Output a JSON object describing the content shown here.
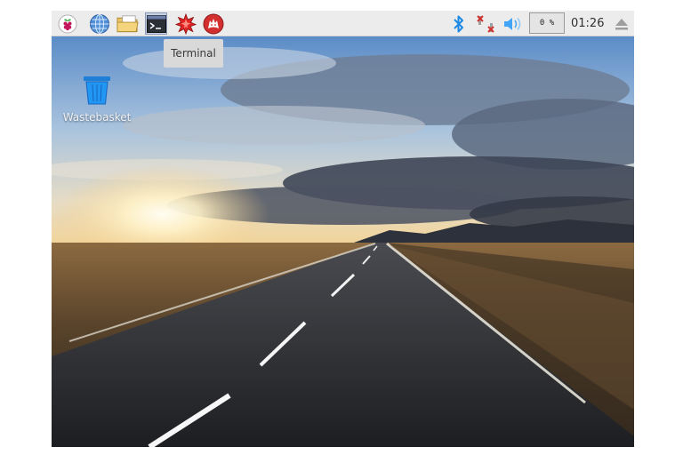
{
  "taskbar": {
    "apps": [
      {
        "name": "raspberry-menu-icon"
      },
      {
        "name": "web-browser-icon"
      },
      {
        "name": "file-manager-icon"
      },
      {
        "name": "terminal-icon"
      },
      {
        "name": "mathematica-icon"
      },
      {
        "name": "wolfram-icon"
      }
    ],
    "tray": {
      "cpu_label": "0 %",
      "clock": "01:26"
    }
  },
  "tooltip": {
    "text": "Terminal"
  },
  "desktop": {
    "icons": [
      {
        "label": "Wastebasket"
      }
    ]
  },
  "colors": {
    "taskbar_bg": "#ececec",
    "bluetooth": "#1e88e5",
    "network_error": "#d32f2f",
    "volume": "#42a5f5"
  }
}
